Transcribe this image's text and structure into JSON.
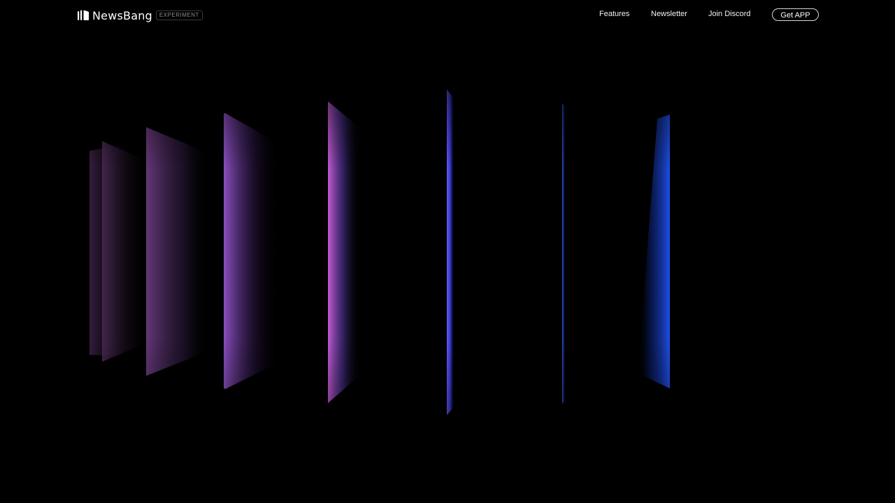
{
  "brand": {
    "name": "NewsBang",
    "badge": "EXPERIMENT",
    "icon": "newsbang-logo-icon"
  },
  "nav": {
    "links": [
      {
        "label": "Features"
      },
      {
        "label": "Newsletter"
      },
      {
        "label": "Join Discord"
      }
    ],
    "cta_label": "Get APP"
  },
  "hero": {
    "decoration": "glowing-panels",
    "colors": {
      "background": "#000000",
      "violet": "#7b3fa8",
      "magenta": "#c55bd0",
      "indigo": "#4a46e6",
      "blue": "#1f4fe8"
    }
  }
}
